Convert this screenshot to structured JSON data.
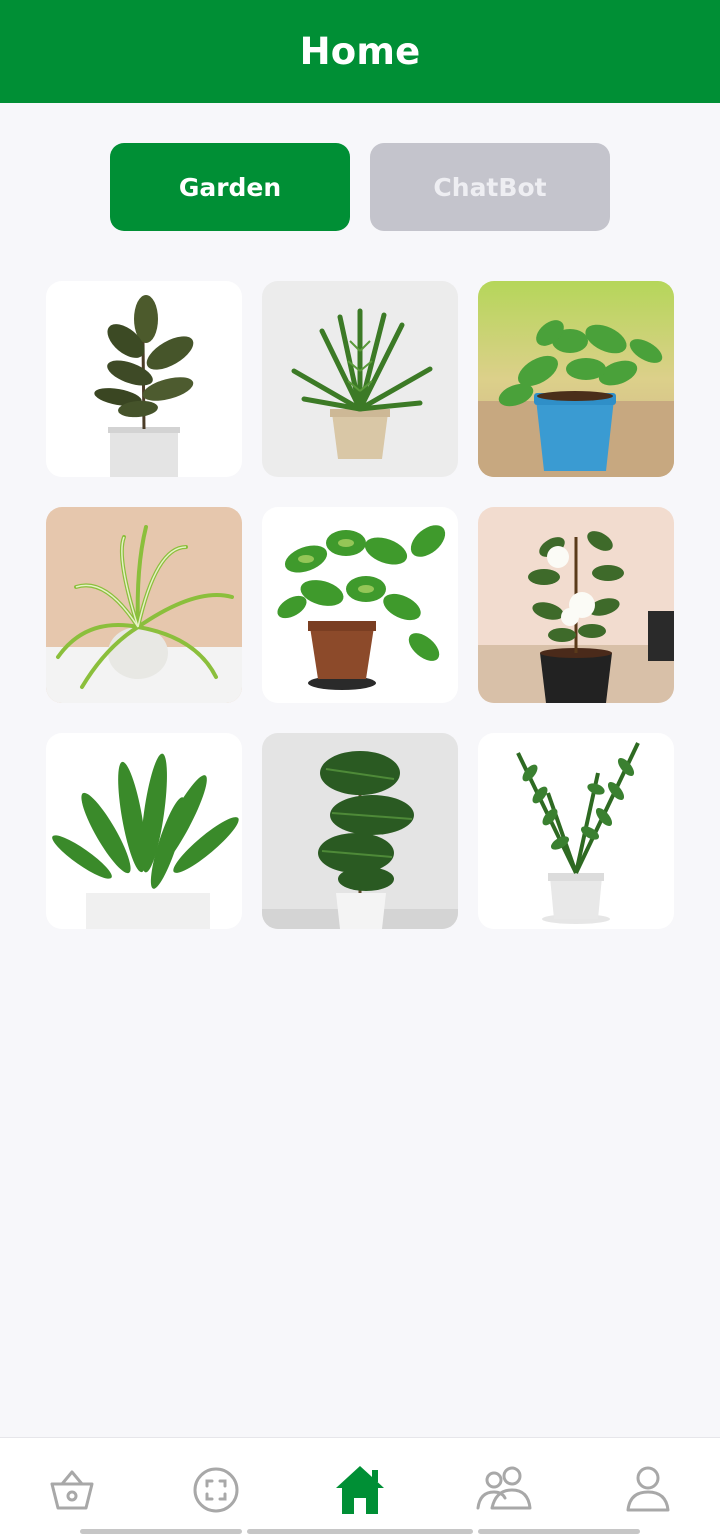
{
  "header": {
    "title": "Home"
  },
  "tabs": [
    {
      "label": "Garden",
      "active": true
    },
    {
      "label": "ChatBot",
      "active": false
    }
  ],
  "plants": [
    {
      "icon": "rubber-plant-image"
    },
    {
      "icon": "fern-plant-image"
    },
    {
      "icon": "pothos-blue-pot-image"
    },
    {
      "icon": "spider-plant-image"
    },
    {
      "icon": "pothos-terracotta-image"
    },
    {
      "icon": "gardenia-plant-image"
    },
    {
      "icon": "cast-iron-plant-image"
    },
    {
      "icon": "dracaena-plant-image"
    },
    {
      "icon": "zz-plant-image"
    }
  ],
  "bottom_nav": [
    {
      "icon": "basket-icon",
      "active": false
    },
    {
      "icon": "scan-icon",
      "active": false
    },
    {
      "icon": "home-icon",
      "active": true
    },
    {
      "icon": "community-icon",
      "active": false
    },
    {
      "icon": "profile-icon",
      "active": false
    }
  ],
  "colors": {
    "brand": "#008f35",
    "inactive_tab": "#c4c4cc",
    "nav_icon": "#a8a8a8"
  }
}
